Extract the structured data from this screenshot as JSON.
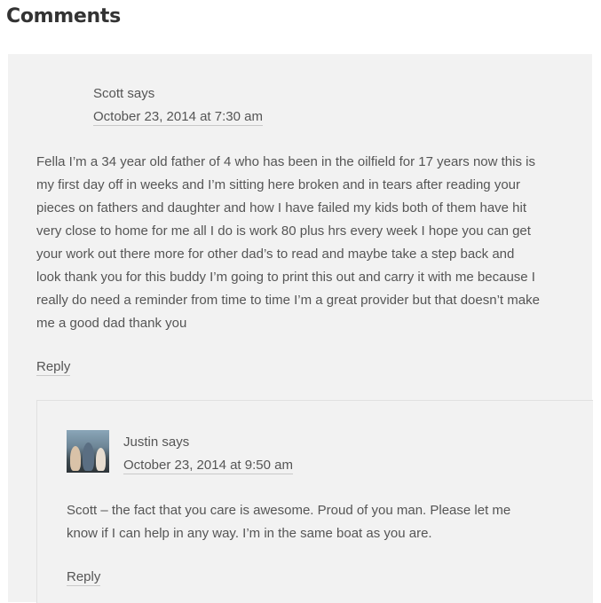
{
  "section": {
    "title": "Comments"
  },
  "comments": [
    {
      "author": "Scott",
      "says": "says",
      "date": "October 23, 2014 at 7:30 am",
      "lines": [
        "Fella I’m a 34 year old father of 4 who has been in the oilfield for 17 years now this is",
        "my first day off in weeks and I’m sitting here broken and in tears after reading your",
        "pieces on fathers and daughter and how I have failed my kids both of them have hit",
        "very close to home for me all I do is work 80 plus hrs every week I hope you can get",
        "your work out there more for other dad’s to read and maybe take a step back and",
        "look thank you for this buddy I’m going to print this out and carry it with me because I",
        "really do need a reminder from time to time I’m a great provider but that doesn’t make",
        "me a good dad thank you"
      ],
      "reply_label": "Reply"
    },
    {
      "author": "Justin",
      "says": "says",
      "date": "October 23, 2014 at 9:50 am",
      "lines": [
        "Scott – the fact that you care is awesome. Proud of you man. Please let me",
        "know if I can help in any way. I’m in the same boat as you are."
      ],
      "reply_label": "Reply"
    }
  ]
}
